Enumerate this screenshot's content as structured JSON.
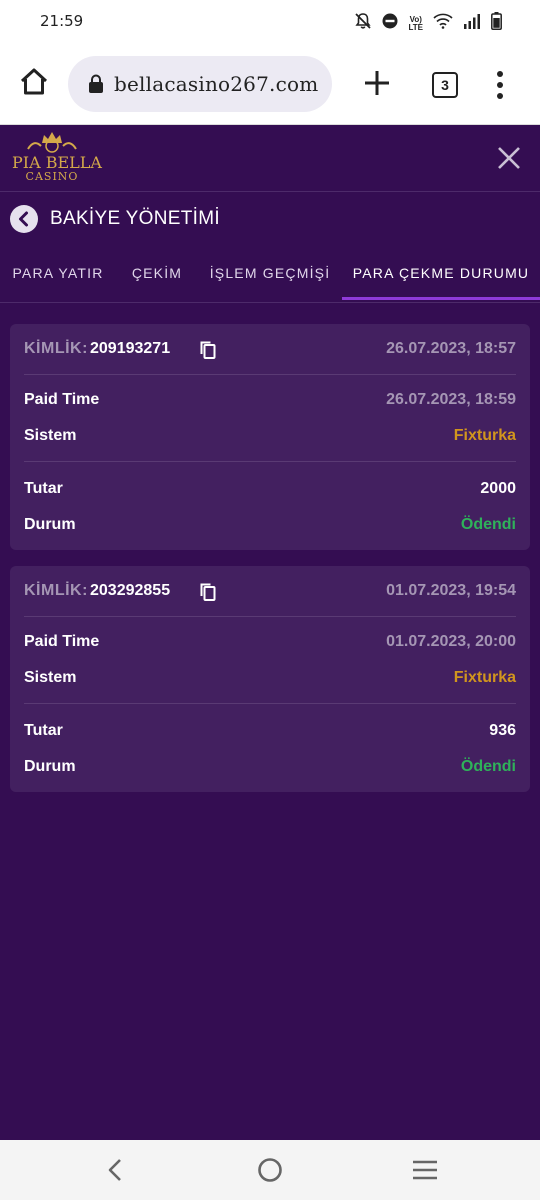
{
  "status_bar": {
    "time": "21:59",
    "volte_top": "Vo)",
    "volte_bottom": "LTE",
    "icons": [
      "bell-off-icon",
      "do-not-disturb-icon",
      "volte-icon",
      "wifi-icon",
      "signal-icon",
      "battery-icon"
    ]
  },
  "browser": {
    "url": "bellacasino267.com",
    "tab_count": "3",
    "icons": [
      "home-icon",
      "lock-icon",
      "plus-icon",
      "tabs-icon",
      "kebab-menu-icon"
    ]
  },
  "header": {
    "logo_title": "PIA BELLA",
    "logo_subtitle": "CASINO",
    "brand_color": "#d4a94a"
  },
  "page": {
    "title": "BAKİYE YÖNETİMİ"
  },
  "tabs": [
    {
      "label": "PARA YATIR",
      "active": false
    },
    {
      "label": "ÇEKİM",
      "active": false
    },
    {
      "label": "İŞLEM GEÇMİŞİ",
      "active": false
    },
    {
      "label": "PARA ÇEKME DURUMU",
      "active": true
    }
  ],
  "withdrawals": [
    {
      "id_label": "KİMLİK:",
      "id": "209193271",
      "date": "26.07.2023, 18:57",
      "rows": [
        {
          "label": "Paid Time",
          "value": "26.07.2023, 18:59"
        },
        {
          "label": "Sistem",
          "value": "Fixturka"
        },
        {
          "label": "Tutar",
          "value": "2000"
        },
        {
          "label": "Durum",
          "value": "Ödendi"
        }
      ]
    },
    {
      "id_label": "KİMLİK:",
      "id": "203292855",
      "date": "01.07.2023, 19:54",
      "rows": [
        {
          "label": "Paid Time",
          "value": "01.07.2023, 20:00"
        },
        {
          "label": "Sistem",
          "value": "Fixturka"
        },
        {
          "label": "Tutar",
          "value": "936"
        },
        {
          "label": "Durum",
          "value": "Ödendi"
        }
      ]
    }
  ],
  "colors": {
    "background": "#340d52",
    "card": "#432060",
    "active_tab": "#8e3ad8",
    "system_value": "#d1951e",
    "status_paid": "#2fb25a"
  },
  "nav_bar": {
    "icons": [
      "back-chevron-icon",
      "home-circle-icon",
      "recents-menu-icon"
    ]
  }
}
